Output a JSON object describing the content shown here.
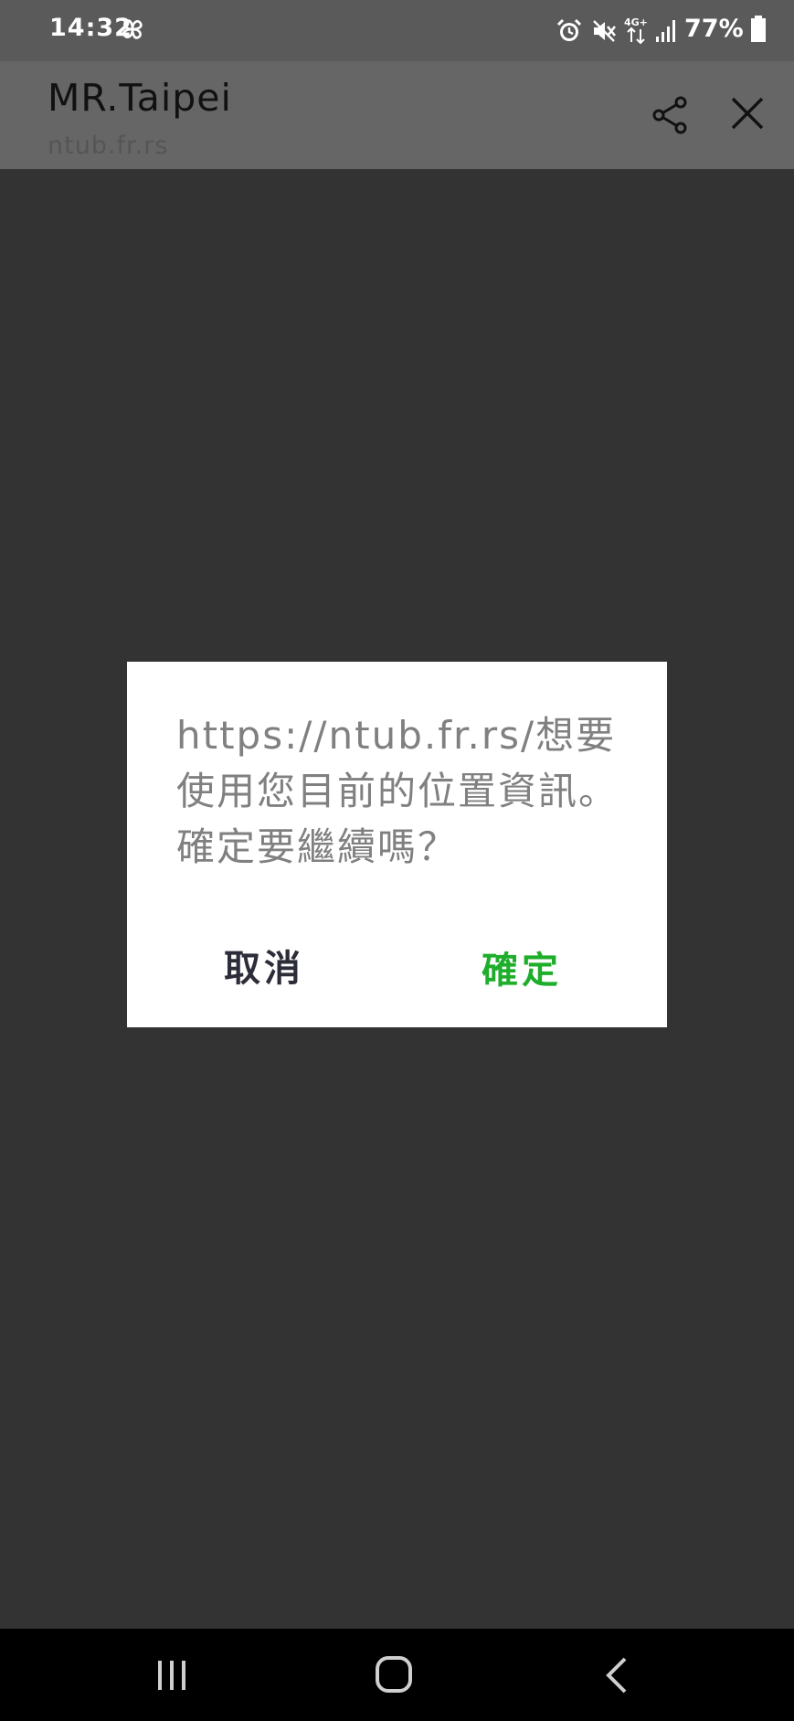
{
  "status_bar": {
    "time": "14:32",
    "battery": "77%",
    "icons": [
      "pinwheel-icon",
      "alarm-icon",
      "mute-icon",
      "4g-plus-icon",
      "signal-icon",
      "battery-icon"
    ],
    "network": "4G+"
  },
  "app_bar": {
    "title": "MR.Taipei",
    "url": "ntub.fr.rs",
    "icons": [
      "share-icon",
      "close-icon"
    ]
  },
  "dialog": {
    "message": "https://ntub.fr.rs/想要使用您目前的位置資訊。確定要繼續嗎？",
    "cancel_label": "取消",
    "confirm_label": "確定"
  },
  "nav_bar": {
    "icons": [
      "recent-apps-icon",
      "home-icon",
      "back-icon"
    ]
  },
  "colors": {
    "status_bar_bg": "#5a5a5a",
    "app_bar_bg": "#666666",
    "overlay_bg": "#333333",
    "dialog_bg": "#ffffff",
    "message_text": "#808080",
    "confirm_accent": "#1fae2b",
    "nav_bar_bg": "#000000"
  }
}
